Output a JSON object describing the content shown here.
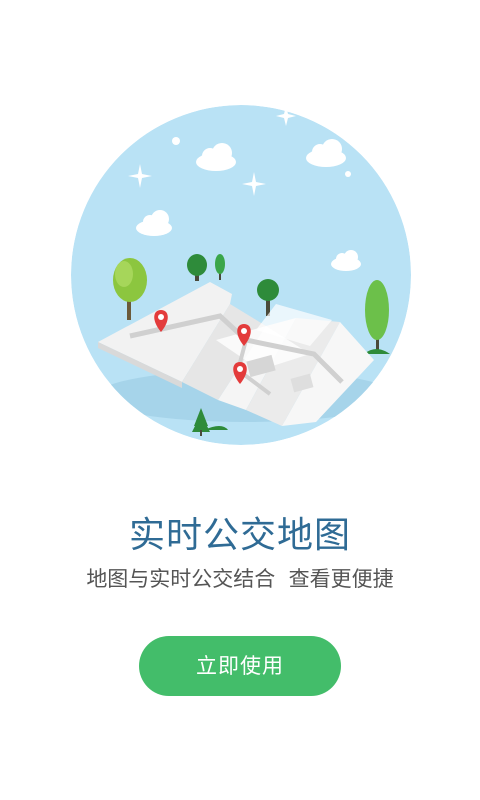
{
  "onboarding": {
    "title": "实时公交地图",
    "subtitle": "地图与实时公交结合  查看更便捷",
    "start_button_label": "立即使用"
  },
  "colors": {
    "title": "#2f6b95",
    "subtitle": "#555555",
    "button_bg": "#43bd6a",
    "button_text": "#ffffff",
    "sky_circle": "#b9e2f5"
  },
  "illustration": {
    "icon": "folded-map-with-location-pins-icon"
  }
}
